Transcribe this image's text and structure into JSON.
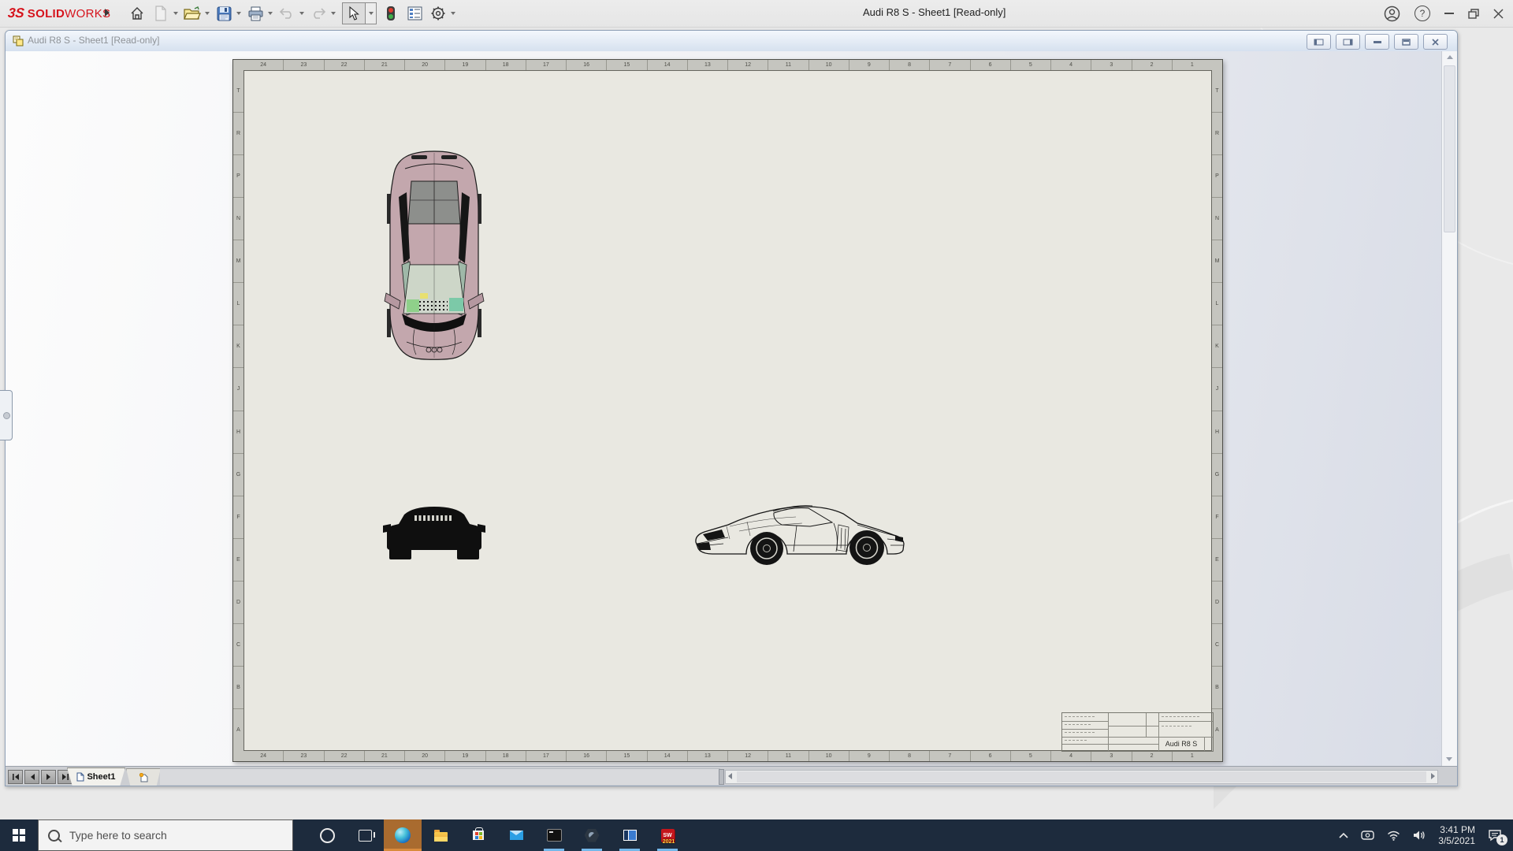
{
  "colors": {
    "taskbar_bg": "#1d2b3d",
    "brand_red": "#d6131c",
    "sheet_bg": "#e9e8e1",
    "zone_strip": "#c5c5bf",
    "car_body_pink": "#c3a7ad",
    "open_app_underline": "#74b8ea",
    "edge_highlight": "#a96b2f",
    "viewport_gradient_end": "#d8dce6"
  },
  "app": {
    "brand_mark": "3S",
    "brand_bold": "SOLID",
    "brand_light": "WORKS",
    "title": "Audi R8 S - Sheet1 [Read-only]",
    "toolbar_tools": [
      "home",
      "new-document",
      "open",
      "save",
      "print",
      "undo",
      "redo",
      "select",
      "rebuild",
      "file-properties",
      "options"
    ],
    "window_controls": [
      "account",
      "help",
      "minimize",
      "restore",
      "close"
    ],
    "help_glyph": "?"
  },
  "doc_window": {
    "title": "Audi R8 S - Sheet1 [Read-only]",
    "controls": [
      "pane-left",
      "pane-right",
      "minimize",
      "restore",
      "close"
    ],
    "sheet_tab_label": "Sheet1",
    "views": [
      "top-view",
      "front-view",
      "side-view"
    ]
  },
  "sheet": {
    "zone_columns": [
      "24",
      "23",
      "22",
      "21",
      "20",
      "19",
      "18",
      "17",
      "16",
      "15",
      "14",
      "13",
      "12",
      "11",
      "10",
      "9",
      "8",
      "7",
      "6",
      "5",
      "4",
      "3",
      "2",
      "1"
    ],
    "zone_rows": [
      "T",
      "R",
      "P",
      "N",
      "M",
      "L",
      "K",
      "J",
      "H",
      "G",
      "F",
      "E",
      "D",
      "C",
      "B",
      "A"
    ],
    "title_block": {
      "part_name": "Audi R8 S"
    }
  },
  "taskbar": {
    "search_placeholder": "Type here to search",
    "apps": [
      "start",
      "search",
      "cortana",
      "task-view",
      "edge",
      "file-explorer",
      "microsoft-store",
      "mail",
      "command-prompt",
      "3d-app",
      "media-app",
      "solidworks-2021"
    ],
    "open_apps": [
      "command-prompt",
      "3d-app",
      "media-app",
      "solidworks-2021"
    ],
    "active_app": "edge",
    "sw_label": "SW",
    "sw_year": "2021",
    "tray": {
      "time": "3:41 PM",
      "date": "3/5/2021",
      "notification_count": "1"
    }
  }
}
